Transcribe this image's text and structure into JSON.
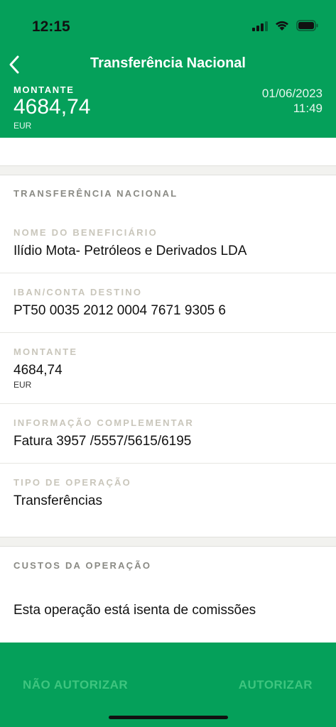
{
  "status_bar": {
    "time": "12:15"
  },
  "nav": {
    "title": "Transferência Nacional"
  },
  "summary": {
    "amount_label": "MONTANTE",
    "amount": "4684,74",
    "currency": "EUR",
    "date": "01/06/2023",
    "time": "11:49"
  },
  "transfer": {
    "section_title": "TRANSFERÊNCIA NACIONAL",
    "beneficiary_label": "NOME DO BENEFICIÁRIO",
    "beneficiary": "Ilídio Mota- Petróleos e Derivados LDA",
    "iban_label": "IBAN/CONTA DESTINO",
    "iban": "PT50 0035 2012 0004 7671 9305 6",
    "amount_label": "MONTANTE",
    "amount": "4684,74",
    "currency": "EUR",
    "info_label": "INFORMAÇÃO COMPLEMENTAR",
    "info": "Fatura 3957 /5557/5615/6195",
    "type_label": "TIPO DE OPERAÇÃO",
    "type": "Transferências"
  },
  "costs": {
    "section_title": "CUSTOS DA OPERAÇÃO",
    "text": "Esta operação está isenta de comissões"
  },
  "actions": {
    "reject_label": "NÃO AUTORIZAR",
    "approve_label": "AUTORIZAR"
  },
  "colors": {
    "brand_green": "#05a05a",
    "button_text": "#3ec57f"
  },
  "icons": [
    "back-chevron-icon",
    "cellular-signal-icon",
    "wifi-icon",
    "battery-icon"
  ]
}
